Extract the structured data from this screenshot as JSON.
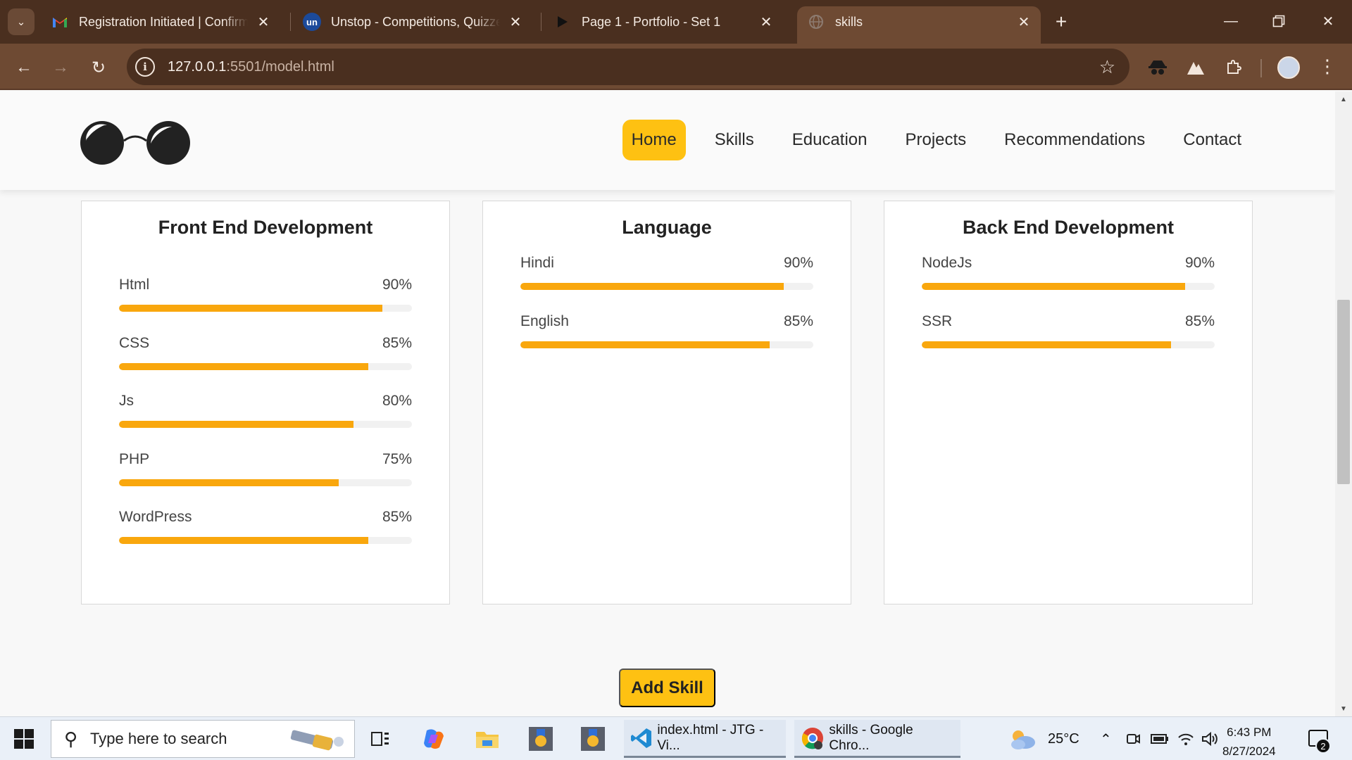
{
  "browser": {
    "tabs": [
      {
        "title": "Registration Initiated | Confirmation",
        "favicon": "gmail-icon",
        "close": "✕"
      },
      {
        "title": "Unstop - Competitions, Quizzes",
        "favicon": "unstop-icon",
        "favicon_text": "un",
        "close": "✕"
      },
      {
        "title": "Page 1 - Portfolio - Set 1",
        "favicon": "play-icon",
        "close": "✕"
      },
      {
        "title": "skills",
        "favicon": "globe-icon",
        "close": "✕",
        "active": true
      }
    ],
    "url_host": "127.0.0.1",
    "url_rest": ":5501/model.html",
    "colors": {
      "frame": "#4a2f1f",
      "toolbar": "#6e4a33"
    }
  },
  "site": {
    "nav": [
      {
        "label": "Home",
        "active": true
      },
      {
        "label": "Skills"
      },
      {
        "label": "Education"
      },
      {
        "label": "Projects"
      },
      {
        "label": "Recommendations"
      },
      {
        "label": "Contact"
      }
    ],
    "cards": [
      {
        "title": "Front End Development",
        "skills": [
          {
            "name": "Html",
            "percent_label": "90%",
            "level": 0.9
          },
          {
            "name": "CSS",
            "percent_label": "85%",
            "level": 0.85
          },
          {
            "name": "Js",
            "percent_label": "80%",
            "level": 0.8
          },
          {
            "name": "PHP",
            "percent_label": "75%",
            "level": 0.75
          },
          {
            "name": "WordPress",
            "percent_label": "85%",
            "level": 0.85
          }
        ]
      },
      {
        "title": "Language",
        "skills": [
          {
            "name": "Hindi",
            "percent_label": "90%",
            "level": 0.9
          },
          {
            "name": "English",
            "percent_label": "85%",
            "level": 0.85
          }
        ]
      },
      {
        "title": "Back End Development",
        "skills": [
          {
            "name": "NodeJs",
            "percent_label": "90%",
            "level": 0.9
          },
          {
            "name": "SSR",
            "percent_label": "85%",
            "level": 0.85
          }
        ]
      }
    ],
    "add_button": "Add Skill",
    "colors": {
      "accent": "#fec112",
      "bar": "#f9a70d",
      "track": "#f1f1f1"
    }
  },
  "taskbar": {
    "search_placeholder": "Type here to search",
    "windows": [
      {
        "label": "index.html - JTG - Vi...",
        "icon": "vscode-icon"
      },
      {
        "label": "skills - Google Chro...",
        "icon": "chrome-icon"
      }
    ],
    "weather": "25°C",
    "time": "6:43 PM",
    "date": "8/27/2024",
    "notifications": "2"
  }
}
